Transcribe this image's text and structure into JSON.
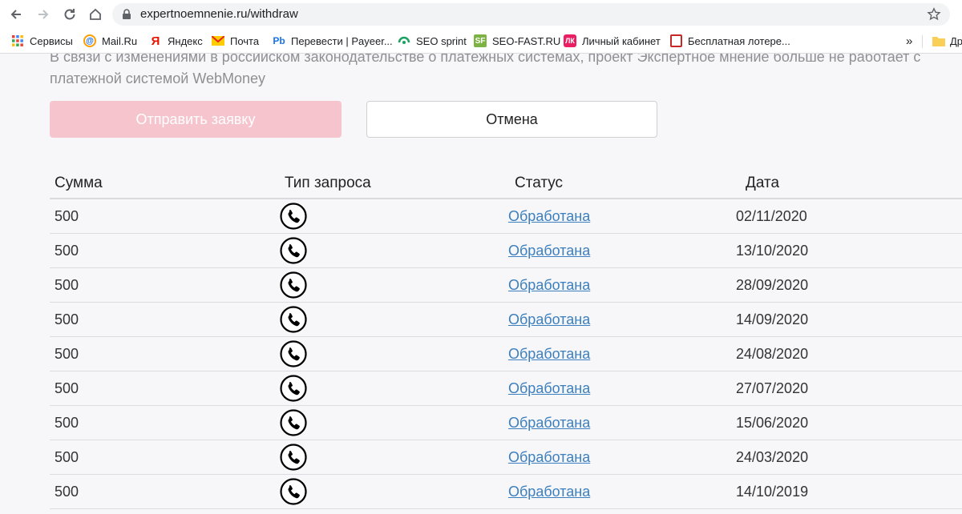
{
  "browser": {
    "url": "expertnoemnenie.ru/withdraw",
    "bookmarks": [
      {
        "label": "Сервисы",
        "icon": "apps-grid-icon"
      },
      {
        "label": "Mail.Ru",
        "icon": "mailru-icon"
      },
      {
        "label": "Яндекс",
        "icon": "yandex-icon"
      },
      {
        "label": "Почта",
        "icon": "mail-envelope-icon"
      },
      {
        "label": "Перевести | Payeer...",
        "icon": "payeer-icon"
      },
      {
        "label": "SEO sprint",
        "icon": "seosprint-icon"
      },
      {
        "label": "SEO-FAST.RU",
        "icon": "seofast-icon"
      },
      {
        "label": "Личный кабинет",
        "icon": "cabinet-icon"
      },
      {
        "label": "Бесплатная лотере...",
        "icon": "lottery-icon"
      }
    ],
    "more": "»",
    "folder_label": "Др"
  },
  "page": {
    "notice": "В связи с изменениями в российском законодательстве о платежных системах, проект Экспертное мнение больше не работает с платежной системой WebMoney",
    "submit_label": "Отправить заявку",
    "cancel_label": "Отмена",
    "table": {
      "headers": [
        "Сумма",
        "Тип запроса",
        "Статус",
        "Дата"
      ],
      "rows": [
        {
          "sum": "500",
          "type": "phone-icon",
          "status": "Обработана",
          "date": "02/11/2020"
        },
        {
          "sum": "500",
          "type": "phone-icon",
          "status": "Обработана",
          "date": "13/10/2020"
        },
        {
          "sum": "500",
          "type": "phone-icon",
          "status": "Обработана",
          "date": "28/09/2020"
        },
        {
          "sum": "500",
          "type": "phone-icon",
          "status": "Обработана",
          "date": "14/09/2020"
        },
        {
          "sum": "500",
          "type": "phone-icon",
          "status": "Обработана",
          "date": "24/08/2020"
        },
        {
          "sum": "500",
          "type": "phone-icon",
          "status": "Обработана",
          "date": "27/07/2020"
        },
        {
          "sum": "500",
          "type": "phone-icon",
          "status": "Обработана",
          "date": "15/06/2020"
        },
        {
          "sum": "500",
          "type": "phone-icon",
          "status": "Обработана",
          "date": "24/03/2020"
        },
        {
          "sum": "500",
          "type": "phone-icon",
          "status": "Обработана",
          "date": "14/10/2019"
        }
      ]
    }
  },
  "colors": {
    "submit_bg": "#f6c4cd",
    "link": "#3b7fbf",
    "notice_text": "#8f8f94",
    "page_bg": "#f7f7f9"
  }
}
